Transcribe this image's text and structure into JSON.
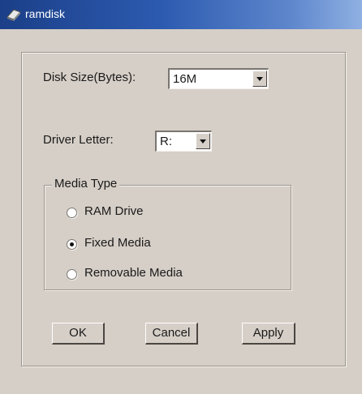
{
  "window": {
    "title": "ramdisk",
    "icon": "ramdisk-app-icon"
  },
  "disk_size": {
    "label": "Disk Size(Bytes):",
    "value": "16M"
  },
  "driver_letter": {
    "label": "Driver Letter:",
    "value": "R:"
  },
  "media_type": {
    "legend": "Media Type",
    "options": [
      {
        "label": "RAM Drive",
        "selected": false
      },
      {
        "label": "Fixed Media",
        "selected": true
      },
      {
        "label": "Removable Media",
        "selected": false
      }
    ]
  },
  "buttons": {
    "ok": "OK",
    "cancel": "Cancel",
    "apply": "Apply"
  }
}
